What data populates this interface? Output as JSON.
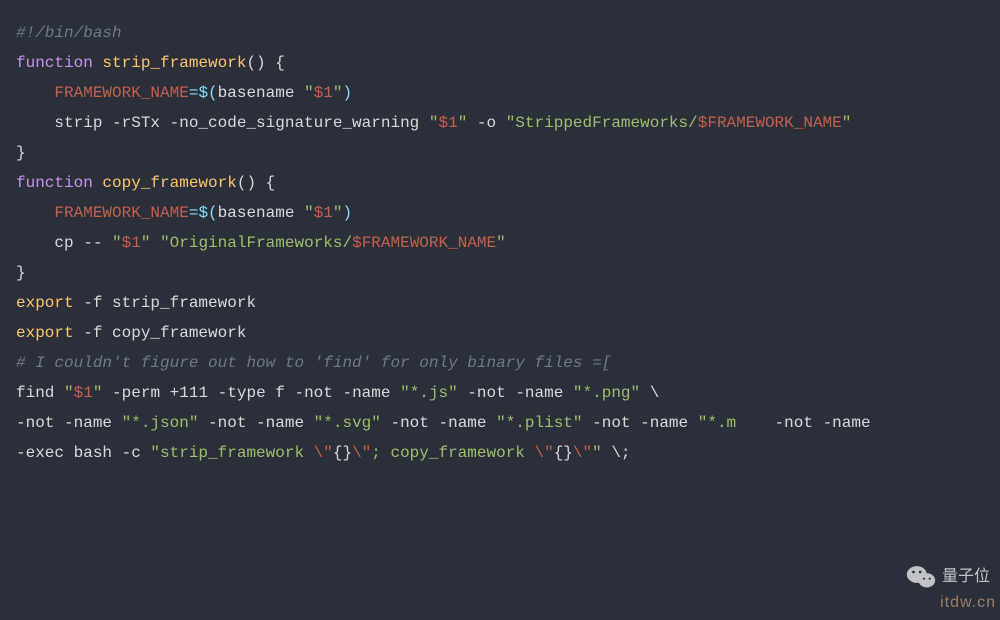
{
  "code": {
    "l1": "#!/bin/bash",
    "l2": "",
    "l3_kw": "function",
    "l3_fn": " strip_framework",
    "l3_rest": "() {",
    "l4_indent": "    ",
    "l4_var": "FRAMEWORK_NAME",
    "l4_eq": "=",
    "l4_dol": "$(",
    "l4_cmd": "basename ",
    "l4_str": "\"",
    "l4_arg": "$1",
    "l4_strend": "\"",
    "l4_close": ")",
    "l5_indent": "    ",
    "l5_a": "strip ",
    "l5_b": "-rSTx -no_code_signature_warning ",
    "l5_c": "\"",
    "l5_d": "$1",
    "l5_e": "\"",
    "l5_f": " -o ",
    "l5_g": "\"StrippedFrameworks/",
    "l5_h": "$FRAMEWORK_NAME",
    "l5_i": "\"",
    "l6": "}",
    "l7": "",
    "l8_kw": "function",
    "l8_fn": " copy_framework",
    "l8_rest": "() {",
    "l9_indent": "    ",
    "l9_var": "FRAMEWORK_NAME",
    "l9_eq": "=",
    "l9_dol": "$(",
    "l9_cmd": "basename ",
    "l9_str": "\"",
    "l9_arg": "$1",
    "l9_strend": "\"",
    "l9_close": ")",
    "l10_indent": "    ",
    "l10_a": "cp ",
    "l10_b": "-- ",
    "l10_c": "\"",
    "l10_d": "$1",
    "l10_e": "\"",
    "l10_f": " ",
    "l10_g": "\"OriginalFrameworks/",
    "l10_h": "$FRAMEWORK_NAME",
    "l10_i": "\"",
    "l11": "}",
    "l12": "",
    "l13_a": "export",
    "l13_b": " -f strip_framework",
    "l14_a": "export",
    "l14_b": " -f copy_framework",
    "l15": "",
    "l16": "# I couldn't figure out how to 'find' for only binary files =[",
    "l17_a": "find ",
    "l17_b": "\"",
    "l17_c": "$1",
    "l17_d": "\"",
    "l17_e": " -perm +111 -type f -not -name ",
    "l17_f": "\"*.js\"",
    "l17_g": " -not -name ",
    "l17_h": "\"*.png\"",
    "l17_i": " \\",
    "l18_a": "-not -name ",
    "l18_b": "\"*.json\"",
    "l18_c": " -not -name ",
    "l18_d": "\"*.svg\"",
    "l18_e": " -not -name ",
    "l18_f": "\"*.plist\"",
    "l18_g": " -not -name ",
    "l18_h": "\"*.m",
    "l18_i": " -not -name",
    "l19_a": "-exec bash -c ",
    "l19_b": "\"strip_framework ",
    "l19_c": "\\\"",
    "l19_d": "{}",
    "l19_e": "\\\"",
    "l19_f": "; copy_framework ",
    "l19_g": "\\\"",
    "l19_h": "{}",
    "l19_i": "\\\"",
    "l19_j": "\"",
    "l19_k": " \\;"
  },
  "watermark": {
    "text": "量子位"
  },
  "footer": "itdw.cn"
}
